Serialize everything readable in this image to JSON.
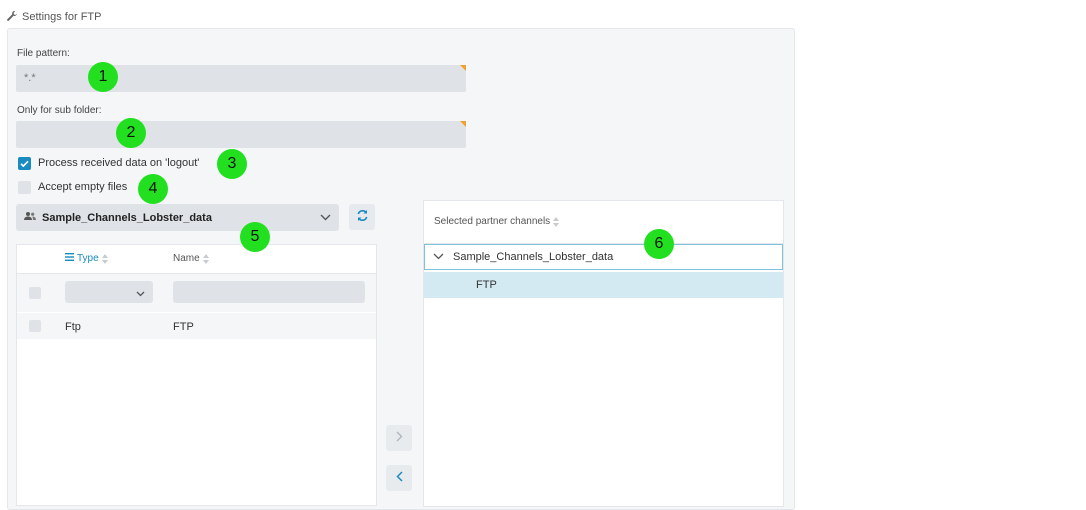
{
  "header": {
    "title": "Settings for FTP",
    "icon": "wrench-icon"
  },
  "fields": {
    "file_pattern": {
      "label": "File pattern:",
      "value": "*.*"
    },
    "sub_folder": {
      "label": "Only for sub folder:",
      "value": ""
    }
  },
  "checkboxes": {
    "process_logout": {
      "label": "Process received data on 'logout'",
      "checked": true
    },
    "accept_empty": {
      "label": "Accept empty files",
      "checked": false
    }
  },
  "partner_select": {
    "value": "Sample_Channels_Lobster_data",
    "icon": "users-icon"
  },
  "available_table": {
    "columns": {
      "type": "Type",
      "name": "Name"
    },
    "rows": [
      {
        "type": "Ftp",
        "name": "FTP"
      }
    ]
  },
  "selected_channels": {
    "header": "Selected partner channels",
    "group": "Sample_Channels_Lobster_data",
    "items": [
      "FTP"
    ]
  },
  "annotations": [
    "1",
    "2",
    "3",
    "4",
    "5",
    "6"
  ],
  "colors": {
    "accent": "#1a8ac0",
    "badge": "#22e01f",
    "field_bg": "#dfe3e8",
    "selected_row": "#d4eaf3"
  }
}
